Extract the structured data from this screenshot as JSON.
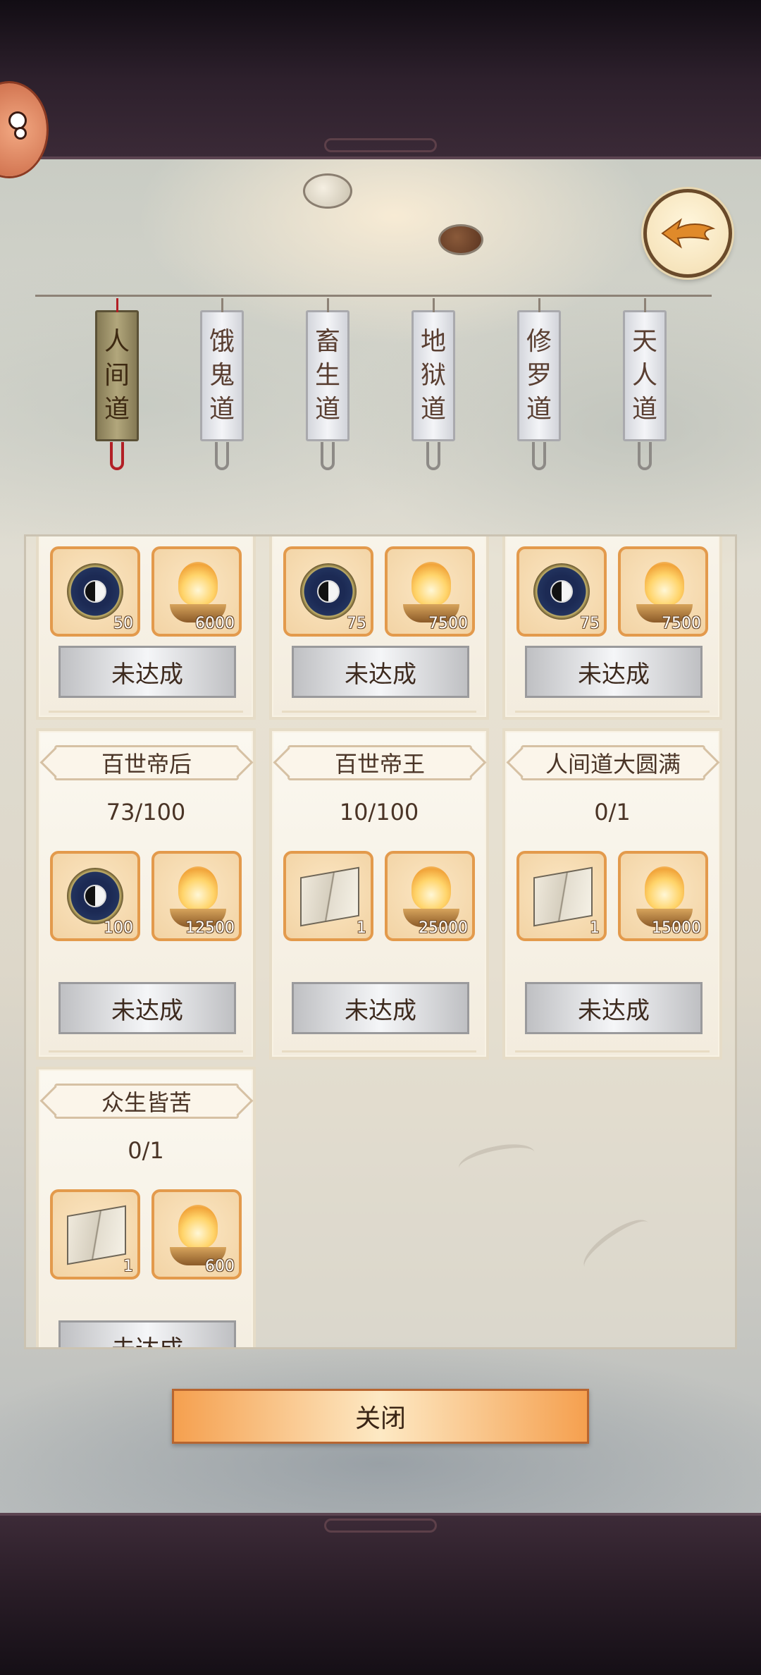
{
  "colors": {
    "accent_orange": "#f5a04f",
    "card_border": "#e39a4c",
    "active_tab": "#b2a77c",
    "text_dark": "#4a3426"
  },
  "tabs": [
    {
      "chars": [
        "人",
        "间",
        "道"
      ],
      "active": true
    },
    {
      "chars": [
        "饿",
        "鬼",
        "道"
      ],
      "active": false
    },
    {
      "chars": [
        "畜",
        "生",
        "道"
      ],
      "active": false
    },
    {
      "chars": [
        "地",
        "狱",
        "道"
      ],
      "active": false
    },
    {
      "chars": [
        "修",
        "罗",
        "道"
      ],
      "active": false
    },
    {
      "chars": [
        "天",
        "人",
        "道"
      ],
      "active": false
    }
  ],
  "achievements_row1": [
    {
      "items": [
        {
          "icon": "bagua-compass-icon",
          "count": "50"
        },
        {
          "icon": "incense-burner-icon",
          "count": "6000"
        }
      ],
      "button": "未达成"
    },
    {
      "items": [
        {
          "icon": "bagua-compass-icon",
          "count": "75"
        },
        {
          "icon": "incense-burner-icon",
          "count": "7500"
        }
      ],
      "button": "未达成"
    },
    {
      "items": [
        {
          "icon": "bagua-compass-icon",
          "count": "75"
        },
        {
          "icon": "incense-burner-icon",
          "count": "7500"
        }
      ],
      "button": "未达成"
    }
  ],
  "achievements_row2": [
    {
      "title": "百世帝后",
      "progress": "73/100",
      "items": [
        {
          "icon": "bagua-compass-icon",
          "count": "100"
        },
        {
          "icon": "incense-burner-icon",
          "count": "12500"
        }
      ],
      "button": "未达成"
    },
    {
      "title": "百世帝王",
      "progress": "10/100",
      "items": [
        {
          "icon": "scripture-book-icon",
          "count": "1"
        },
        {
          "icon": "incense-burner-icon",
          "count": "25000"
        }
      ],
      "button": "未达成"
    },
    {
      "title": "人间道大圆满",
      "progress": "0/1",
      "items": [
        {
          "icon": "scripture-book-icon",
          "count": "1"
        },
        {
          "icon": "incense-burner-icon",
          "count": "15000"
        }
      ],
      "button": "未达成"
    }
  ],
  "achievements_row3": [
    {
      "title": "众生皆苦",
      "progress": "0/1",
      "items": [
        {
          "icon": "scripture-book-icon",
          "count": "1"
        },
        {
          "icon": "incense-burner-icon",
          "count": "600"
        }
      ],
      "button": "未达成"
    }
  ],
  "close_label": "关闭"
}
